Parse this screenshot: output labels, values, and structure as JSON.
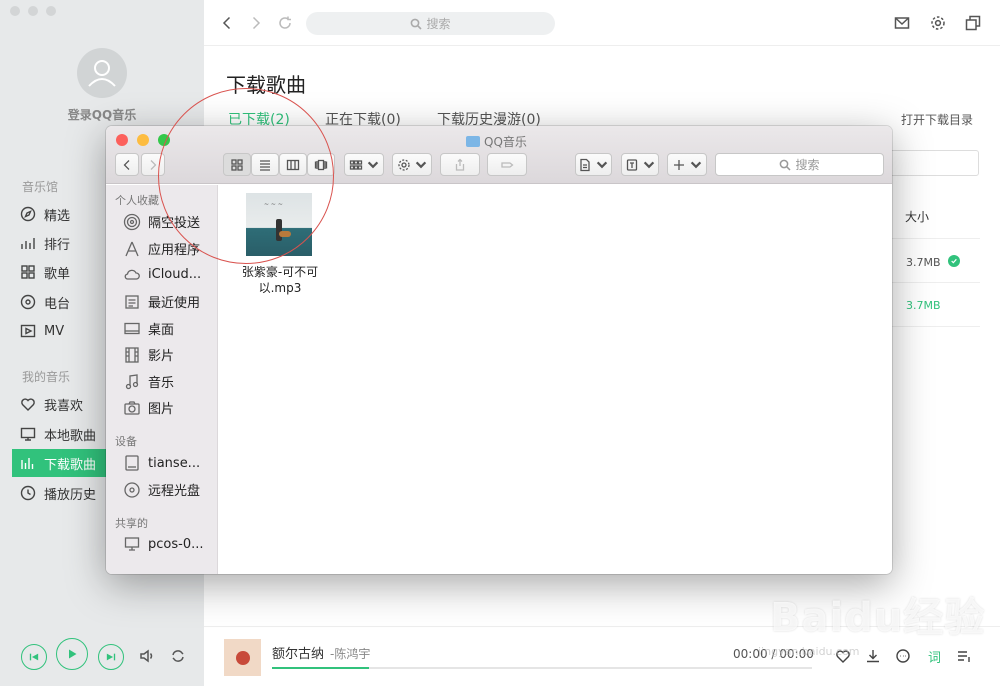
{
  "sidebar": {
    "login_text": "登录QQ音乐",
    "login_sub": "",
    "section_music_hall": "音乐馆",
    "music_hall": [
      {
        "label": "精选",
        "icon": "compass-icon"
      },
      {
        "label": "排行",
        "icon": "chart-icon"
      },
      {
        "label": "歌单",
        "icon": "grid-icon"
      },
      {
        "label": "电台",
        "icon": "radio-icon"
      },
      {
        "label": "MV",
        "icon": "video-icon"
      }
    ],
    "section_my_music": "我的音乐",
    "my_music": [
      {
        "label": "我喜欢",
        "icon": "heart-icon"
      },
      {
        "label": "本地歌曲",
        "icon": "monitor-icon"
      },
      {
        "label": "下载歌曲",
        "icon": "bars-icon",
        "active": true
      },
      {
        "label": "播放历史",
        "icon": "clock-icon"
      }
    ]
  },
  "topbar": {
    "search_placeholder": "搜索"
  },
  "main": {
    "title": "下载歌曲",
    "tabs": [
      {
        "label": "已下载(2)",
        "active": true
      },
      {
        "label": "正在下载(0)",
        "active": false
      },
      {
        "label": "下载历史漫游(0)",
        "active": false
      }
    ],
    "open_dir": "打开下载目录",
    "size_header": "大小",
    "sizes": [
      "3.7MB",
      "3.7MB"
    ]
  },
  "finder": {
    "title": "QQ音乐",
    "search_placeholder": "搜索",
    "sections": [
      {
        "header": "个人收藏",
        "items": [
          {
            "label": "隔空投送",
            "icon": "airdrop-icon"
          },
          {
            "label": "应用程序",
            "icon": "applications-icon"
          },
          {
            "label": "iCloud...",
            "icon": "cloud-icon"
          },
          {
            "label": "最近使用",
            "icon": "recents-icon"
          },
          {
            "label": "桌面",
            "icon": "desktop-icon"
          },
          {
            "label": "影片",
            "icon": "film-icon"
          },
          {
            "label": "音乐",
            "icon": "music-note-icon"
          },
          {
            "label": "图片",
            "icon": "camera-icon"
          }
        ]
      },
      {
        "header": "设备",
        "items": [
          {
            "label": "tianse...",
            "icon": "disk-icon"
          },
          {
            "label": "远程光盘",
            "icon": "optical-disc-icon"
          }
        ]
      },
      {
        "header": "共享的",
        "items": [
          {
            "label": "pcos-0...",
            "icon": "computer-icon"
          }
        ]
      }
    ],
    "files": [
      {
        "name": "张紫豪-可不可以.mp3"
      }
    ]
  },
  "player": {
    "song": "额尔古纳",
    "artist": "-陈鸿宇",
    "time": "00:00 / 00:00",
    "progress": 0.18,
    "lyric_label": "词"
  },
  "watermark": {
    "brand": "Baidu经验",
    "url": "jingyan.baidu.com"
  },
  "colors": {
    "accent": "#31c27c",
    "finder_close": "#fc605c",
    "finder_minimize": "#fdbc40",
    "finder_zoom": "#34c84a",
    "annotation": "#d9534f"
  }
}
